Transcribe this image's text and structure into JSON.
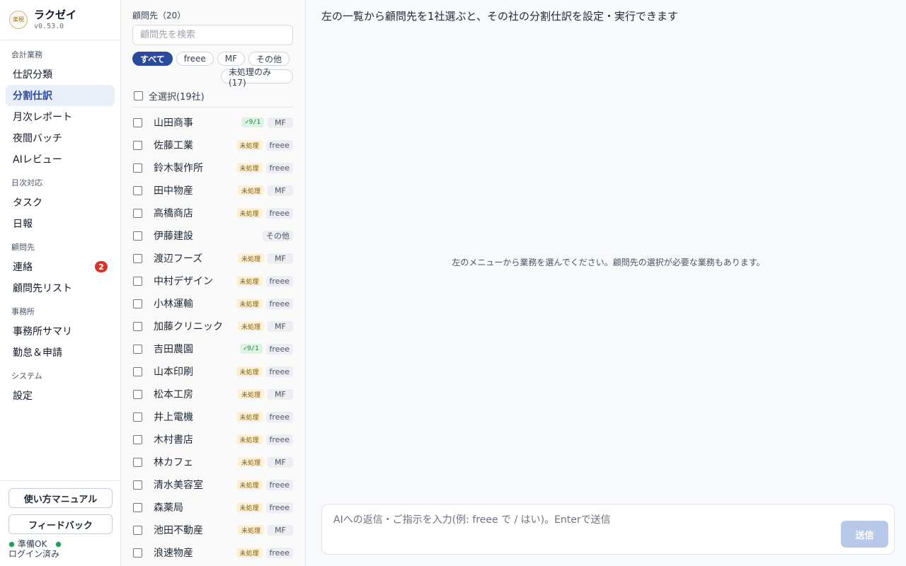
{
  "app": {
    "name": "ラクゼイ",
    "version": "v0.53.0",
    "logo_text": "楽税"
  },
  "nav": {
    "sections": [
      {
        "title": "会計業務",
        "items": [
          {
            "label": "仕訳分類",
            "active": false
          },
          {
            "label": "分割仕訳",
            "active": true
          },
          {
            "label": "月次レポート",
            "active": false
          },
          {
            "label": "夜間バッチ",
            "active": false
          },
          {
            "label": "AIレビュー",
            "active": false
          }
        ]
      },
      {
        "title": "日次対応",
        "items": [
          {
            "label": "タスク",
            "active": false
          },
          {
            "label": "日報",
            "active": false
          }
        ]
      },
      {
        "title": "顧問先",
        "items": [
          {
            "label": "連絡",
            "active": false,
            "badge": "2"
          },
          {
            "label": "顧問先リスト",
            "active": false
          }
        ]
      },
      {
        "title": "事務所",
        "items": [
          {
            "label": "事務所サマリ",
            "active": false
          },
          {
            "label": "勤怠＆申請",
            "active": false
          }
        ]
      },
      {
        "title": "システム",
        "items": [
          {
            "label": "設定",
            "active": false
          }
        ]
      }
    ]
  },
  "footer": {
    "manual_label": "使い方マニュアル",
    "feedback_label": "フィードバック",
    "status_ready": "準備OK",
    "status_login": "ログイン済み",
    "status_color": "#1f9d55"
  },
  "clients": {
    "header": "顧問先（20）",
    "search_placeholder": "顧問先を検索",
    "filters": [
      {
        "label": "すべて",
        "active": true
      },
      {
        "label": "freee",
        "active": false
      },
      {
        "label": "MF",
        "active": false
      },
      {
        "label": "その他",
        "active": false
      },
      {
        "label": "未処理のみ(17)",
        "active": false
      }
    ],
    "select_all_label": "全選択(19社)",
    "rows": [
      {
        "name": "山田商事",
        "status": "✓9/1",
        "status_type": "done",
        "system": "MF"
      },
      {
        "name": "佐藤工業",
        "status": "未処理",
        "status_type": "pending",
        "system": "freee"
      },
      {
        "name": "鈴木製作所",
        "status": "未処理",
        "status_type": "pending",
        "system": "freee"
      },
      {
        "name": "田中物産",
        "status": "未処理",
        "status_type": "pending",
        "system": "MF"
      },
      {
        "name": "高橋商店",
        "status": "未処理",
        "status_type": "pending",
        "system": "freee"
      },
      {
        "name": "伊藤建設",
        "status": "",
        "status_type": "none",
        "system": "その他"
      },
      {
        "name": "渡辺フーズ",
        "status": "未処理",
        "status_type": "pending",
        "system": "MF"
      },
      {
        "name": "中村デザイン",
        "status": "未処理",
        "status_type": "pending",
        "system": "freee"
      },
      {
        "name": "小林運輸",
        "status": "未処理",
        "status_type": "pending",
        "system": "freee"
      },
      {
        "name": "加藤クリニック",
        "status": "未処理",
        "status_type": "pending",
        "system": "MF"
      },
      {
        "name": "吉田農園",
        "status": "✓9/1",
        "status_type": "done",
        "system": "freee"
      },
      {
        "name": "山本印刷",
        "status": "未処理",
        "status_type": "pending",
        "system": "freee"
      },
      {
        "name": "松本工房",
        "status": "未処理",
        "status_type": "pending",
        "system": "MF"
      },
      {
        "name": "井上電機",
        "status": "未処理",
        "status_type": "pending",
        "system": "freee"
      },
      {
        "name": "木村書店",
        "status": "未処理",
        "status_type": "pending",
        "system": "freee"
      },
      {
        "name": "林カフェ",
        "status": "未処理",
        "status_type": "pending",
        "system": "MF"
      },
      {
        "name": "清水美容室",
        "status": "未処理",
        "status_type": "pending",
        "system": "freee"
      },
      {
        "name": "森薬局",
        "status": "未処理",
        "status_type": "pending",
        "system": "freee"
      },
      {
        "name": "池田不動産",
        "status": "未処理",
        "status_type": "pending",
        "system": "MF"
      },
      {
        "name": "浪速物産",
        "status": "未処理",
        "status_type": "pending",
        "system": "freee"
      }
    ]
  },
  "main": {
    "title": "左の一覧から顧問先を1社選ぶと、その社の分割仕訳を設定・実行できます",
    "empty_hint": "左のメニューから業務を選んでください。顧問先の選択が必要な業務もあります。",
    "composer_placeholder": "AIへの返信・ご指示を入力(例: freee で / はい)。Enterで送信",
    "send_label": "送信"
  }
}
